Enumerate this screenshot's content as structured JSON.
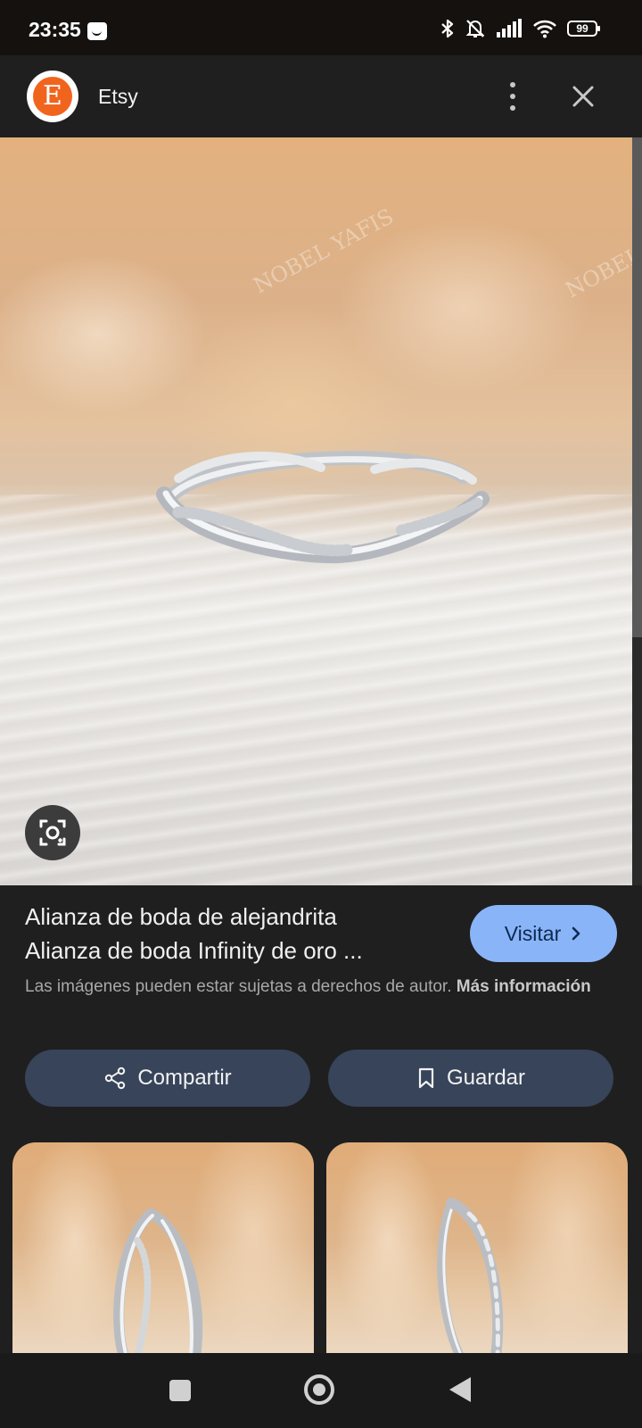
{
  "status_bar": {
    "time": "23:35",
    "battery": "99"
  },
  "header": {
    "logo_letter": "E",
    "site_name": "Etsy"
  },
  "result": {
    "title_line1": "Alianza de boda de alejandrita",
    "title_line2": "Alianza de boda Infinity de oro ...",
    "visit_label": "Visitar",
    "copyright_text": "Las imágenes pueden estar sujetas a derechos de autor.",
    "more_info_label": "Más información",
    "share_label": "Compartir",
    "save_label": "Guardar"
  },
  "watermark": "NOBEL YAFIS",
  "colors": {
    "brand": "#f1641e",
    "visit_button": "#8ab4f8",
    "action_button": "#37445a",
    "background": "#1f1f1f"
  },
  "icons": [
    "smiley-notification-icon",
    "bluetooth-icon",
    "mute-bell-icon",
    "signal-icon",
    "wifi-icon",
    "battery-icon",
    "more-vert-icon",
    "close-icon",
    "lens-search-icon",
    "chevron-right-icon",
    "share-icon",
    "bookmark-icon",
    "recents-icon",
    "home-icon",
    "back-icon"
  ]
}
